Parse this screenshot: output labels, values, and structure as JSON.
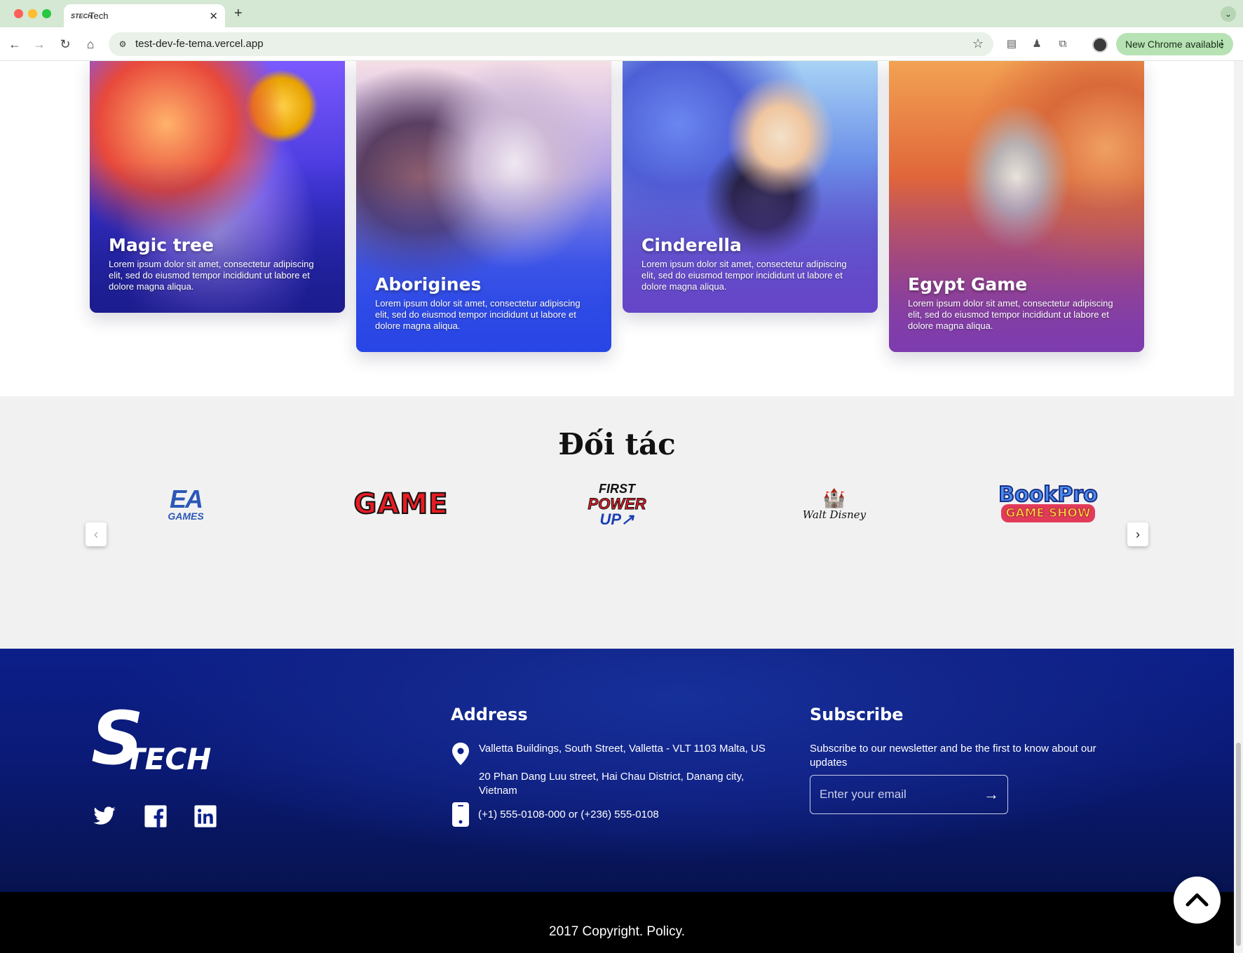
{
  "browser": {
    "tab_title": "Tech",
    "tab_favicon_text": "STECH",
    "new_tab_symbol": "+",
    "url": "test-dev-fe-tema.vercel.app",
    "update_button": "New Chrome available"
  },
  "games": [
    {
      "title": "Magic tree",
      "description": "Lorem ipsum dolor sit amet, consectetur adipiscing elit, sed do eiusmod tempor incididunt ut labore et dolore magna aliqua."
    },
    {
      "title": "Aborigines",
      "description": "Lorem ipsum dolor sit amet, consectetur adipiscing elit, sed do eiusmod tempor incididunt ut labore et dolore magna aliqua."
    },
    {
      "title": "Cinderella",
      "description": "Lorem ipsum dolor sit amet, consectetur adipiscing elit, sed do eiusmod tempor incididunt ut labore et dolore magna aliqua."
    },
    {
      "title": "Egypt Game",
      "description": "Lorem ipsum dolor sit amet, consectetur adipiscing elit, sed do eiusmod tempor incididunt ut labore et dolore magna aliqua."
    }
  ],
  "partners": {
    "title": "Đối tác",
    "logos": {
      "ea_top": "EA",
      "ea_bottom": "GAMES",
      "game": "GAME",
      "fpu_1": "FIRST",
      "fpu_2": "POWER",
      "fpu_3": "UP↗",
      "disney": "Walt Disney",
      "book_1": "BookPro",
      "book_2": "GAME SHOW"
    }
  },
  "footer": {
    "logo_s": "S",
    "logo_text": "TECH",
    "address_heading": "Address",
    "address_1": "Valletta Buildings, South Street, Valletta - VLT 1103 Malta, US",
    "address_2": "20 Phan Dang Luu street, Hai Chau District, Danang city, Vietnam",
    "phone": "(+1) 555-0108-000 or (+236) 555-0108",
    "subscribe_heading": "Subscribe",
    "subscribe_text": "Subscribe to our newsletter and be the first to know about our updates",
    "email_placeholder": "Enter your email",
    "copyright": "2017 Copyright. Policy."
  }
}
